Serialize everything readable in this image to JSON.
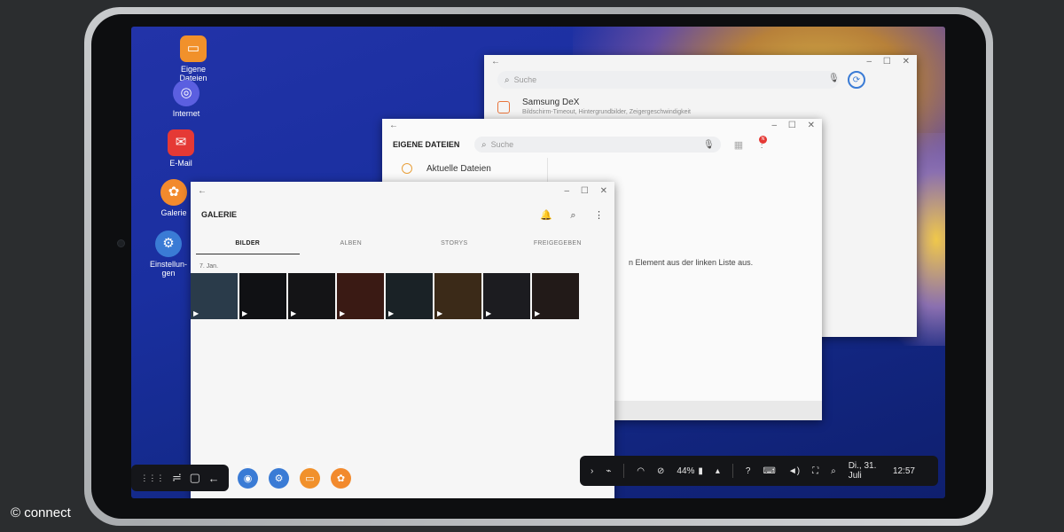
{
  "desktop": {
    "icons": [
      {
        "label": "Eigene\nDateien",
        "icon": "folder-icon",
        "color": "#f1912b"
      },
      {
        "label": "Internet",
        "icon": "internet-planet-icon",
        "color": "#5b5fe0"
      },
      {
        "label": "E-Mail",
        "icon": "mail-icon",
        "color": "#e53935"
      },
      {
        "label": "Galerie",
        "icon": "flower-icon",
        "color": "#f28a2d"
      },
      {
        "label": "Einstellun-\ngen",
        "icon": "gear-icon",
        "color": "#3a7bd5"
      }
    ]
  },
  "settings_window": {
    "back": "←",
    "search_placeholder": "Suche",
    "item_title": "Samsung DeX",
    "item_subtitle": "Bildschirm-Timeout, Hintergrundbilder, Zeigergeschwindigkeit"
  },
  "files_window": {
    "back": "←",
    "title": "EIGENE DATEIEN",
    "search_placeholder": "Suche",
    "badge": "N",
    "recent_label": "Aktuelle Dateien",
    "hint": "n Element aus der linken Liste aus."
  },
  "gallery_window": {
    "back": "←",
    "title": "GALERIE",
    "tabs": [
      "BILDER",
      "ALBEN",
      "STORYS",
      "FREIGEGEBEN"
    ],
    "date": "7. Jan.",
    "thumb_count": 8
  },
  "window_controls": {
    "minimize": "–",
    "maximize": "☐",
    "close": "✕"
  },
  "taskbar": {
    "nav": [
      "⋮⋮⋮",
      "≓",
      "▢",
      "←"
    ],
    "apps": [
      {
        "name": "camera-app",
        "color": "#3a7bd5"
      },
      {
        "name": "settings-app",
        "color": "#3a7bd5"
      },
      {
        "name": "files-app",
        "color": "#f1912b"
      },
      {
        "name": "gallery-app",
        "color": "#f28a2d"
      }
    ],
    "battery": "44%",
    "datetime": "Di., 31. Juli",
    "time": "12:57"
  },
  "watermark": "© connect"
}
